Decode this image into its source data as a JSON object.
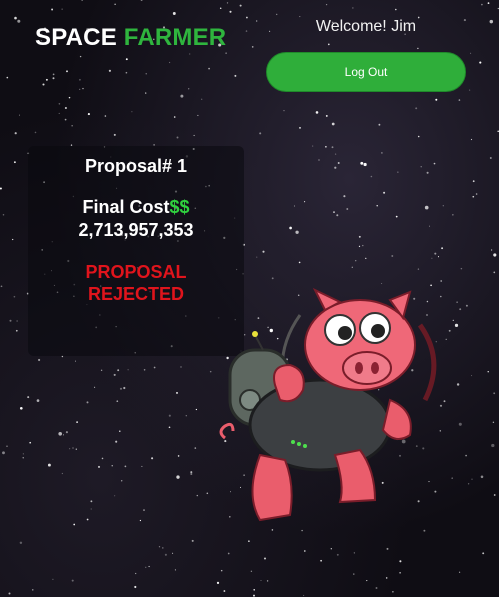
{
  "header": {
    "brand_left": "SPACE",
    "brand_right": "FARMER",
    "welcome_text": "Welcome! Jim",
    "logout_label": "Log Out"
  },
  "proposal": {
    "title": "Proposal# 1",
    "cost_label": "Final Cost",
    "cost_symbol": "$$",
    "cost_value": "2,713,957,353",
    "status_line1": "PROPOSAL",
    "status_line2": "REJECTED"
  },
  "colors": {
    "accent": "#2fb53e",
    "danger": "#e0141c",
    "background": "#0f0d14"
  }
}
